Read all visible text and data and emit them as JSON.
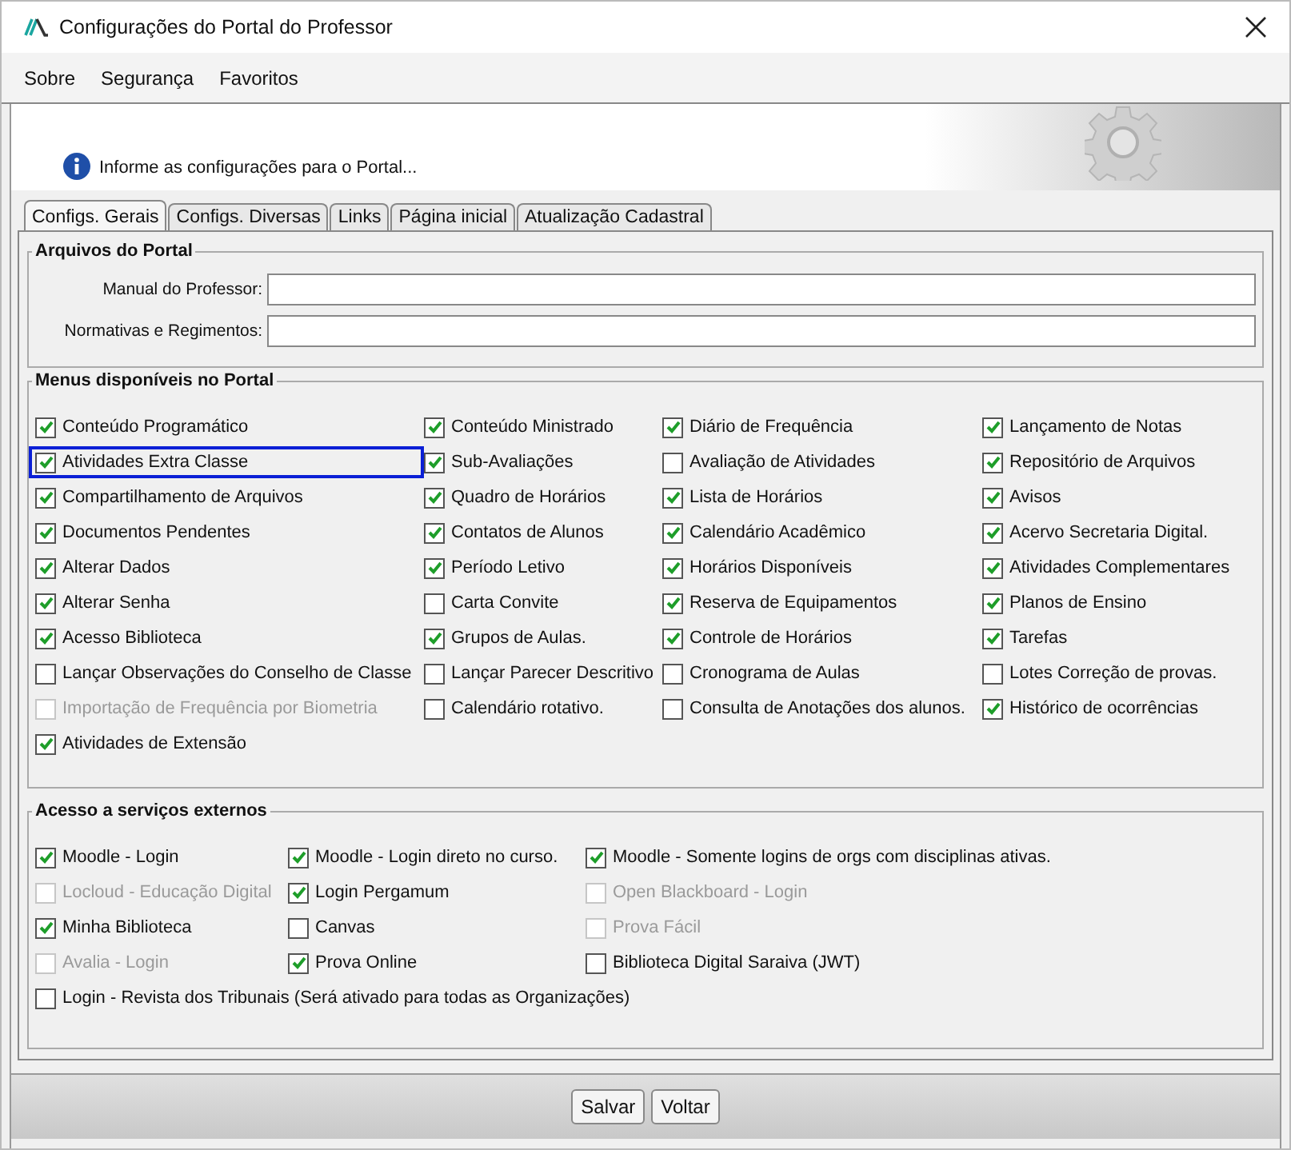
{
  "window": {
    "title": "Configurações do Portal do Professor"
  },
  "menu": [
    {
      "label": "Sobre"
    },
    {
      "label": "Segurança"
    },
    {
      "label": "Favoritos"
    }
  ],
  "banner": {
    "message": "Informe as configurações para o Portal..."
  },
  "tabs": [
    {
      "label": "Configs. Gerais",
      "selected": true
    },
    {
      "label": "Configs. Diversas",
      "selected": false
    },
    {
      "label": "Links",
      "selected": false
    },
    {
      "label": "Página inicial",
      "selected": false
    },
    {
      "label": "Atualização Cadastral",
      "selected": false
    }
  ],
  "files": {
    "title": "Arquivos do Portal",
    "fields": [
      {
        "label": "Manual do Professor:"
      },
      {
        "label": "Normativas e Regimentos:"
      }
    ]
  },
  "menus": {
    "title": "Menus disponíveis no Portal",
    "rows": [
      [
        {
          "label": "Conteúdo Programático",
          "checked": true,
          "disabled": false,
          "highlighted": false
        },
        {
          "label": "Conteúdo Ministrado",
          "checked": true,
          "disabled": false,
          "highlighted": false
        },
        {
          "label": "Diário de Frequência",
          "checked": true,
          "disabled": false,
          "highlighted": false
        },
        {
          "label": "Lançamento de Notas",
          "checked": true,
          "disabled": false,
          "highlighted": false
        }
      ],
      [
        {
          "label": "Atividades Extra Classe",
          "checked": true,
          "disabled": false,
          "highlighted": true
        },
        {
          "label": "Sub-Avaliações",
          "checked": true,
          "disabled": false,
          "highlighted": false
        },
        {
          "label": "Avaliação de Atividades",
          "checked": false,
          "disabled": false,
          "highlighted": false
        },
        {
          "label": "Repositório de Arquivos",
          "checked": true,
          "disabled": false,
          "highlighted": false
        }
      ],
      [
        {
          "label": "Compartilhamento de Arquivos",
          "checked": true,
          "disabled": false,
          "highlighted": false
        },
        {
          "label": "Quadro de Horários",
          "checked": true,
          "disabled": false,
          "highlighted": false
        },
        {
          "label": "Lista de Horários",
          "checked": true,
          "disabled": false,
          "highlighted": false
        },
        {
          "label": "Avisos",
          "checked": true,
          "disabled": false,
          "highlighted": false
        }
      ],
      [
        {
          "label": "Documentos Pendentes",
          "checked": true,
          "disabled": false,
          "highlighted": false
        },
        {
          "label": "Contatos de Alunos",
          "checked": true,
          "disabled": false,
          "highlighted": false
        },
        {
          "label": "Calendário Acadêmico",
          "checked": true,
          "disabled": false,
          "highlighted": false
        },
        {
          "label": "Acervo Secretaria Digital.",
          "checked": true,
          "disabled": false,
          "highlighted": false
        }
      ],
      [
        {
          "label": "Alterar Dados",
          "checked": true,
          "disabled": false,
          "highlighted": false
        },
        {
          "label": "Período Letivo",
          "checked": true,
          "disabled": false,
          "highlighted": false
        },
        {
          "label": "Horários Disponíveis",
          "checked": true,
          "disabled": false,
          "highlighted": false
        },
        {
          "label": "Atividades Complementares",
          "checked": true,
          "disabled": false,
          "highlighted": false
        }
      ],
      [
        {
          "label": "Alterar Senha",
          "checked": true,
          "disabled": false,
          "highlighted": false
        },
        {
          "label": "Carta Convite",
          "checked": false,
          "disabled": false,
          "highlighted": false
        },
        {
          "label": "Reserva de Equipamentos",
          "checked": true,
          "disabled": false,
          "highlighted": false
        },
        {
          "label": "Planos de Ensino",
          "checked": true,
          "disabled": false,
          "highlighted": false
        }
      ],
      [
        {
          "label": "Acesso Biblioteca",
          "checked": true,
          "disabled": false,
          "highlighted": false
        },
        {
          "label": "Grupos de Aulas.",
          "checked": true,
          "disabled": false,
          "highlighted": false
        },
        {
          "label": "Controle de Horários",
          "checked": true,
          "disabled": false,
          "highlighted": false
        },
        {
          "label": "Tarefas",
          "checked": true,
          "disabled": false,
          "highlighted": false
        }
      ],
      [
        {
          "label": "Lançar Observações do Conselho de Classe",
          "checked": false,
          "disabled": false,
          "highlighted": false
        },
        {
          "label": "Lançar Parecer Descritivo",
          "checked": false,
          "disabled": false,
          "highlighted": false
        },
        {
          "label": "Cronograma de Aulas",
          "checked": false,
          "disabled": false,
          "highlighted": false
        },
        {
          "label": "Lotes Correção de provas.",
          "checked": false,
          "disabled": false,
          "highlighted": false
        }
      ],
      [
        {
          "label": "Importação de Frequência por Biometria",
          "checked": false,
          "disabled": true,
          "highlighted": false
        },
        {
          "label": "Calendário rotativo.",
          "checked": false,
          "disabled": false,
          "highlighted": false
        },
        {
          "label": "Consulta de Anotações dos alunos.",
          "checked": false,
          "disabled": false,
          "highlighted": false
        },
        {
          "label": "Histórico de ocorrências",
          "checked": true,
          "disabled": false,
          "highlighted": false
        }
      ],
      [
        {
          "label": "Atividades de Extensão",
          "checked": true,
          "disabled": false,
          "highlighted": false
        }
      ]
    ]
  },
  "services": {
    "title": "Acesso a serviços externos",
    "rows": [
      [
        {
          "label": "Moodle - Login",
          "checked": true,
          "disabled": false
        },
        {
          "label": "Moodle - Login direto no curso.",
          "checked": true,
          "disabled": false
        },
        {
          "label": "Moodle - Somente logins de orgs com disciplinas ativas.",
          "checked": true,
          "disabled": false
        }
      ],
      [
        {
          "label": "Locloud - Educação Digital",
          "checked": false,
          "disabled": true
        },
        {
          "label": "Login Pergamum",
          "checked": true,
          "disabled": false
        },
        {
          "label": "Open Blackboard - Login",
          "checked": false,
          "disabled": true
        }
      ],
      [
        {
          "label": "Minha Biblioteca",
          "checked": true,
          "disabled": false
        },
        {
          "label": "Canvas",
          "checked": false,
          "disabled": false
        },
        {
          "label": "Prova Fácil",
          "checked": false,
          "disabled": true
        }
      ],
      [
        {
          "label": "Avalia - Login",
          "checked": false,
          "disabled": true
        },
        {
          "label": "Prova Online",
          "checked": true,
          "disabled": false
        },
        {
          "label": "Biblioteca Digital Saraiva (JWT)",
          "checked": false,
          "disabled": false
        }
      ],
      [
        {
          "label": "Login - Revista dos Tribunais (Será ativado para todas as Organizações)",
          "checked": false,
          "disabled": false
        }
      ]
    ]
  },
  "buttons": [
    {
      "label": "Salvar"
    },
    {
      "label": "Voltar"
    }
  ]
}
